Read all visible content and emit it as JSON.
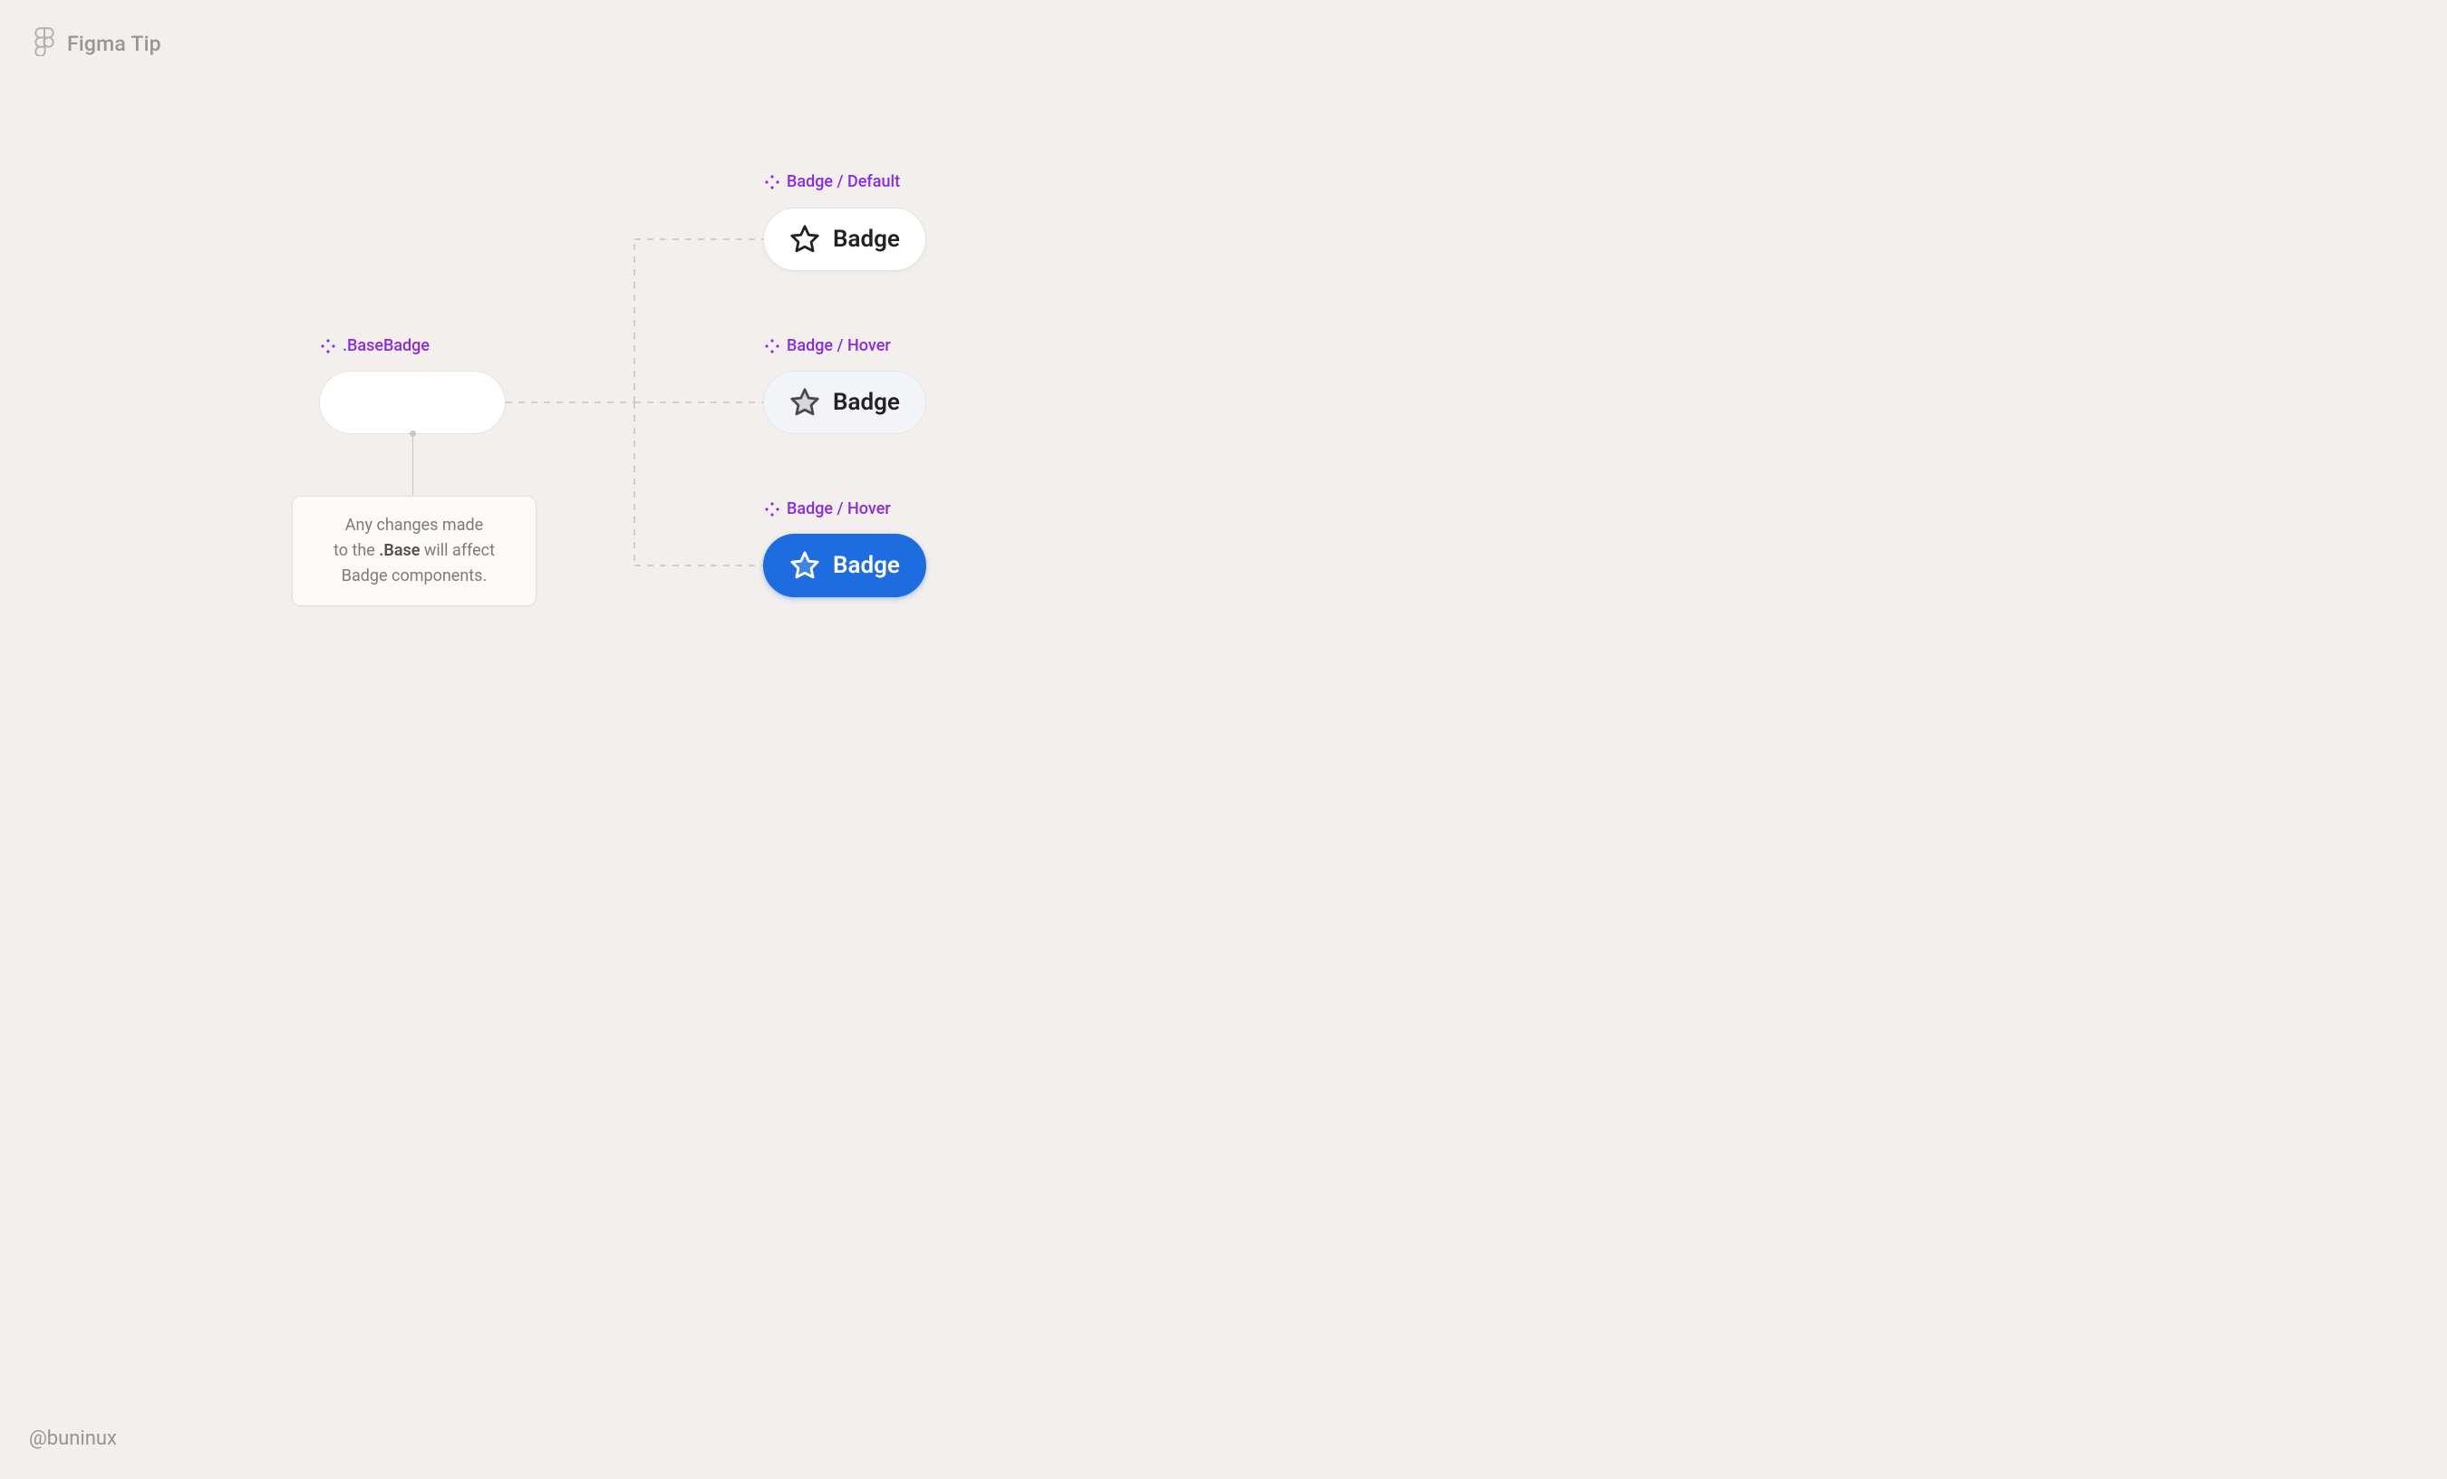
{
  "header": {
    "title": "Figma Tip"
  },
  "footer": {
    "handle": "@buninux"
  },
  "base": {
    "label": ".BaseBadge"
  },
  "note": {
    "line1": "Any changes made",
    "line2a": "to the ",
    "line2b": ".Base",
    "line2c": " will affect",
    "line3": "Badge components."
  },
  "variants": {
    "default": {
      "label": "Badge / Default",
      "text": "Badge"
    },
    "hover": {
      "label": "Badge / Hover",
      "text": "Badge"
    },
    "active": {
      "label": "Badge / Hover",
      "text": "Badge"
    }
  },
  "colors": {
    "brandPurple": "#8a2be2",
    "activeBlue": "#1d6ce0"
  }
}
